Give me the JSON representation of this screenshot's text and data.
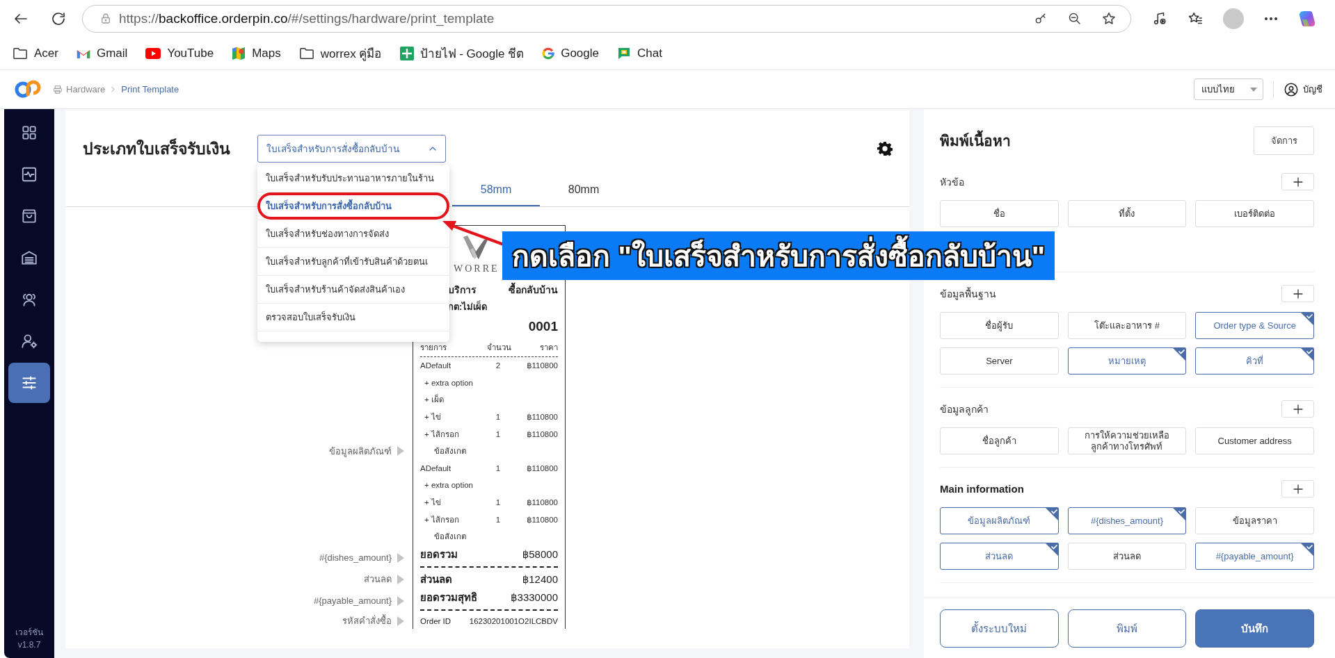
{
  "browser": {
    "url_scheme": "https://",
    "url_host": "backoffice.orderpin.co",
    "url_path": "/#/settings/hardware/print_template"
  },
  "bookmarks": [
    {
      "label": "Acer",
      "kind": "folder"
    },
    {
      "label": "Gmail",
      "kind": "gmail"
    },
    {
      "label": "YouTube",
      "kind": "youtube"
    },
    {
      "label": "Maps",
      "kind": "maps"
    },
    {
      "label": "worrex คู่มือ",
      "kind": "folder"
    },
    {
      "label": "ป้ายไฟ - Google ชีต",
      "kind": "sheets"
    },
    {
      "label": "Google",
      "kind": "google"
    },
    {
      "label": "Chat",
      "kind": "chat"
    }
  ],
  "header": {
    "breadcrumb": [
      "Hardware",
      "Print Template"
    ],
    "language": "แบบไทย",
    "account": "บัญชี"
  },
  "sidebar": {
    "items": [
      {
        "selected": false
      },
      {
        "selected": false
      },
      {
        "selected": false
      },
      {
        "selected": false
      },
      {
        "selected": false
      },
      {
        "selected": false
      },
      {
        "selected": true
      }
    ],
    "version_label": "เวอร์ชัน",
    "version": "v1.8.7"
  },
  "receipt_type": {
    "title": "ประเภทใบเสร็จรับเงิน",
    "value": "ใบเสร็จสำหรับการสั่งซื้อกลับบ้าน",
    "expanded": true,
    "options": [
      {
        "label": "ใบเสร็จสำหรับรับประทานอาหารภายในร้าน",
        "selected": false
      },
      {
        "label": "ใบเสร็จสำหรับการสั่งซื้อกลับบ้าน",
        "selected": true
      },
      {
        "label": "ใบเสร็จสำหรับช่องทางการจัดส่ง",
        "selected": false
      },
      {
        "label": "ใบเสร็จสำหรับลูกค้าที่เข้ารับสินค้าด้วยตนเ",
        "selected": false
      },
      {
        "label": "ใบเสร็จสำหรับร้านค้าจัดส่งสินค้าเอง",
        "selected": false
      },
      {
        "label": "ตรวจสอบใบเสร็จรับเงิน",
        "selected": false
      }
    ]
  },
  "paper_tabs": [
    {
      "label": "58mm",
      "selected": true
    },
    {
      "label": "80mm",
      "selected": false
    }
  ],
  "receipt": {
    "logo_text": "WORRE",
    "service": "บริการ",
    "order_type": "ซื้อกลับบ้าน",
    "note": "กต:ไม่เผ็ด",
    "queue_number": "0001",
    "columns": [
      "รายการ",
      "จำนวน",
      "ราคา"
    ],
    "items_field": "ข้อมูลผลิตภัณฑ์",
    "items": [
      {
        "kind": "item",
        "name": "ADefault",
        "qty": "2",
        "price": "฿110800"
      },
      {
        "kind": "option",
        "name": "+ extra option"
      },
      {
        "kind": "option",
        "name": "+ เผ็ด"
      },
      {
        "kind": "option",
        "name": "+ ไข่",
        "qty": "1",
        "price": "฿110800"
      },
      {
        "kind": "option",
        "name": "+ ไส้กรอก",
        "qty": "1",
        "price": "฿110800"
      },
      {
        "kind": "note",
        "name": "ข้อสังเกต"
      },
      {
        "kind": "item",
        "name": "ADefault",
        "qty": "1",
        "price": "฿110800"
      },
      {
        "kind": "option",
        "name": "+ extra option"
      },
      {
        "kind": "option",
        "name": "+ ไข่",
        "qty": "1",
        "price": "฿110800"
      },
      {
        "kind": "option",
        "name": "+ ไส้กรอก",
        "qty": "1",
        "price": "฿110800"
      },
      {
        "kind": "note",
        "name": "ข้อสังเกต"
      }
    ],
    "summary": [
      {
        "field": "#{dishes_amount}",
        "label": "ยอดรวม",
        "value": "฿58000",
        "divider_after": true
      },
      {
        "field": "ส่วนลด",
        "label": "ส่วนลด",
        "value": "฿12400",
        "divider_after": false
      },
      {
        "field": "#{payable_amount}",
        "label": "ยอดรวมสุทธิ",
        "value": "฿3330000",
        "divider_after": true
      }
    ],
    "order_id": {
      "field": "รหัสคำสั่งซื้อ",
      "label": "Order ID",
      "value": "16230201001O2ILCBDV"
    }
  },
  "content_panel": {
    "title": "พิมพ์เนื้อหา",
    "manage": "จัดการ",
    "sections": [
      {
        "title": "หัวข้อ",
        "fields": [
          {
            "label": "ชื่อ",
            "selected": false
          },
          {
            "label": "ที่ตั้ง",
            "selected": false
          },
          {
            "label": "เบอร์ติดต่อ",
            "selected": false
          }
        ]
      },
      {
        "title": "ข้อมูลพื้นฐาน",
        "fields": [
          {
            "label": "ชื่อผู้รับ",
            "selected": false
          },
          {
            "label": "โต๊ะและอาหาร #",
            "selected": false
          },
          {
            "label": "Order type & Source",
            "selected": true
          },
          {
            "label": "Server",
            "selected": false
          },
          {
            "label": "หมายเหตุ",
            "selected": true
          },
          {
            "label": "คิวที่",
            "selected": true
          }
        ]
      },
      {
        "title": "ข้อมูลลูกค้า",
        "fields": [
          {
            "label": "ชื่อลูกค้า",
            "selected": false
          },
          {
            "label": "การให้ความช่วยเหลือลูกค้าทางโทรศัพท์",
            "selected": false
          },
          {
            "label": "Customer address",
            "selected": false
          }
        ]
      },
      {
        "title": "Main information",
        "fields": [
          {
            "label": "ข้อมูลผลิตภัณฑ์",
            "selected": true
          },
          {
            "label": "#{dishes_amount}",
            "selected": true
          },
          {
            "label": "ข้อมูลราคา",
            "selected": false
          },
          {
            "label": "ส่วนลด",
            "selected": true
          },
          {
            "label": "ส่วนลด",
            "selected": false
          },
          {
            "label": "#{payable_amount}",
            "selected": true
          }
        ]
      }
    ],
    "footer": [
      {
        "label": "ตั้งระบบใหม่",
        "kind": "outline"
      },
      {
        "label": "พิมพ์",
        "kind": "outline"
      },
      {
        "label": "บันทึก",
        "kind": "primary"
      }
    ]
  },
  "annotation": {
    "text": "กดเลือก \"ใบเสร็จสำหรับการสั่งซื้อกลับบ้าน\""
  }
}
